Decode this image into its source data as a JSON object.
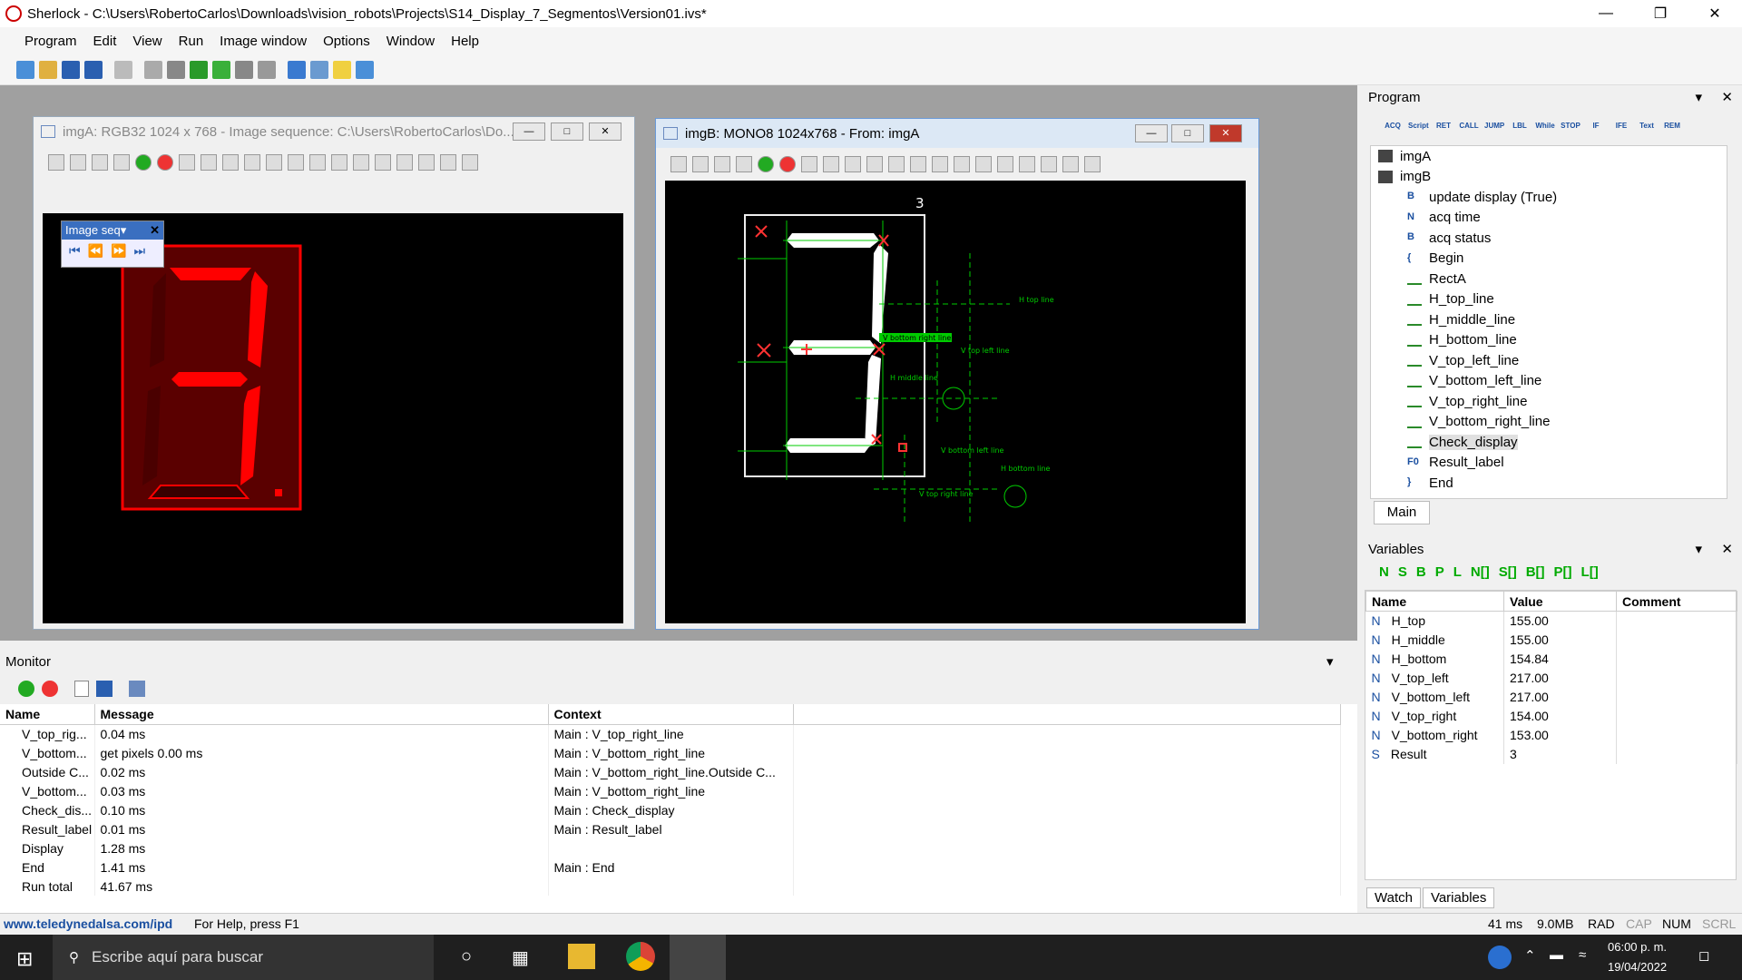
{
  "window": {
    "title": "Sherlock - C:\\Users\\RobertoCarlos\\Downloads\\vision_robots\\Projects\\S14_Display_7_Segmentos\\Version01.ivs*"
  },
  "menu": [
    "Program",
    "Edit",
    "View",
    "Run",
    "Image window",
    "Options",
    "Window",
    "Help"
  ],
  "imgA": {
    "title": "imgA: RGB32 1024 x 768 - Image sequence: C:\\Users\\RobertoCarlos\\Do...",
    "seq_label": "Image seq▾"
  },
  "imgB": {
    "title": "imgB: MONO8 1024x768 - From: imgA",
    "roi_label": "3",
    "labels": [
      "H top line",
      "V top left line",
      "H middle line",
      "V bottom left line",
      "H bottom line",
      "V top right line",
      "V bottom right line"
    ]
  },
  "monitor": {
    "title": "Monitor",
    "headers": [
      "Name",
      "Message",
      "Context"
    ],
    "rows": [
      [
        "V_top_rig...",
        "0.04 ms",
        "Main : V_top_right_line"
      ],
      [
        "V_bottom...",
        "get pixels 0.00 ms",
        "Main : V_bottom_right_line"
      ],
      [
        "Outside C...",
        "0.02 ms",
        "Main : V_bottom_right_line.Outside C..."
      ],
      [
        "V_bottom...",
        "0.03 ms",
        "Main : V_bottom_right_line"
      ],
      [
        "Check_dis...",
        "0.10 ms",
        "Main : Check_display"
      ],
      [
        "Result_label",
        "0.01 ms",
        "Main : Result_label"
      ],
      [
        "Display",
        "1.28 ms",
        ""
      ],
      [
        "End",
        "1.41 ms",
        "Main : End"
      ],
      [
        "Run total",
        "41.67 ms",
        ""
      ]
    ]
  },
  "program": {
    "title": "Program",
    "tool_labels": [
      "ACQ",
      "Script",
      "RET",
      "CALL",
      "JUMP",
      "LBL",
      "While",
      "STOP",
      "IF",
      "IFE",
      "Text",
      "REM"
    ],
    "tree": [
      {
        "label": "imgA",
        "prefix": ""
      },
      {
        "label": "imgB",
        "prefix": ""
      },
      {
        "label": "update display (True)",
        "prefix": "B"
      },
      {
        "label": "acq time",
        "prefix": "N"
      },
      {
        "label": "acq status",
        "prefix": "B"
      },
      {
        "label": "Begin",
        "prefix": "{"
      },
      {
        "label": "RectA",
        "prefix": ""
      },
      {
        "label": "H_top_line",
        "prefix": ""
      },
      {
        "label": "H_middle_line",
        "prefix": ""
      },
      {
        "label": "H_bottom_line",
        "prefix": ""
      },
      {
        "label": "V_top_left_line",
        "prefix": ""
      },
      {
        "label": "V_bottom_left_line",
        "prefix": ""
      },
      {
        "label": "V_top_right_line",
        "prefix": ""
      },
      {
        "label": "V_bottom_right_line",
        "prefix": ""
      },
      {
        "label": "Check_display",
        "prefix": ""
      },
      {
        "label": "Result_label",
        "prefix": "F0"
      },
      {
        "label": "End",
        "prefix": "}"
      }
    ],
    "tab": "Main"
  },
  "variables": {
    "title": "Variables",
    "type_buttons": [
      "N",
      "S",
      "B",
      "P",
      "L",
      "N[]",
      "S[]",
      "B[]",
      "P[]",
      "L[]"
    ],
    "headers": [
      "Name",
      "Value",
      "Comment"
    ],
    "rows": [
      {
        "type": "N",
        "name": "H_top",
        "value": "155.00"
      },
      {
        "type": "N",
        "name": "H_middle",
        "value": "155.00"
      },
      {
        "type": "N",
        "name": "H_bottom",
        "value": "154.84"
      },
      {
        "type": "N",
        "name": "V_top_left",
        "value": "217.00"
      },
      {
        "type": "N",
        "name": "V_bottom_left",
        "value": "217.00"
      },
      {
        "type": "N",
        "name": "V_top_right",
        "value": "154.00"
      },
      {
        "type": "N",
        "name": "V_bottom_right",
        "value": "153.00"
      },
      {
        "type": "S",
        "name": "Result",
        "value": "3"
      }
    ],
    "tabs": [
      "Watch",
      "Variables"
    ]
  },
  "status": {
    "link": "www.teledynedalsa.com/ipd",
    "help": "For Help, press F1",
    "time": "41 ms",
    "mem": "9.0MB",
    "rad": "RAD",
    "cap": "CAP",
    "num": "NUM",
    "scrl": "SCRL"
  },
  "taskbar": {
    "search": "Escribe aquí para buscar",
    "time": "06:00 p. m.",
    "date": "19/04/2022"
  }
}
